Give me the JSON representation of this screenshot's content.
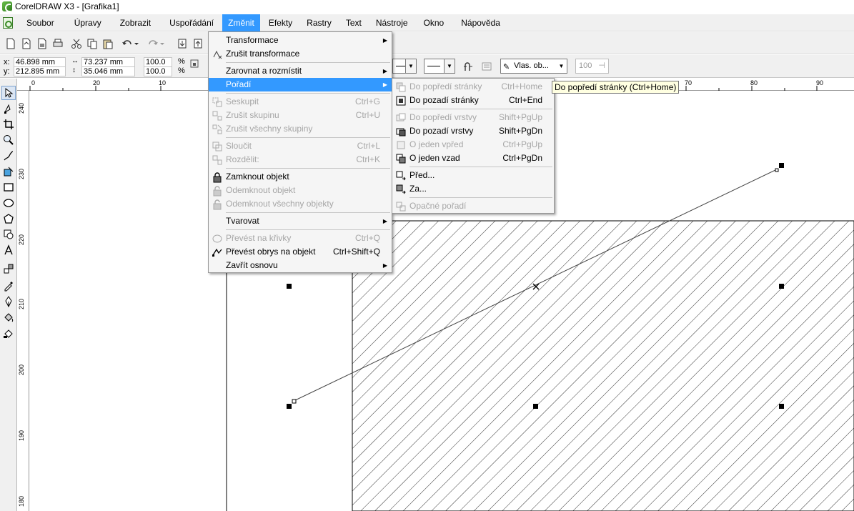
{
  "window": {
    "title": "CorelDRAW X3 - [Grafika1]"
  },
  "menubar": {
    "items": [
      "Soubor",
      "Úpravy",
      "Zobrazit",
      "Uspořádání",
      "Změnit",
      "Efekty",
      "Rastry",
      "Text",
      "Nástroje",
      "Okno",
      "Nápověda"
    ],
    "active": "Změnit"
  },
  "propbar": {
    "x_label": "x:",
    "x_value": "46.898 mm",
    "y_label": "y:",
    "y_value": "212.895 mm",
    "w_value": "73.237 mm",
    "h_value": "35.046 mm",
    "sx_value": "100.0",
    "sy_value": "100.0",
    "pct1": "%",
    "pct2": "%",
    "outline_combo": "Vlas. ob...",
    "opacity_value": "100"
  },
  "rulers": {
    "h_ticks": [
      "0",
      "20",
      "10",
      "70",
      "80",
      "90"
    ],
    "v_ticks": [
      "240",
      "230",
      "220",
      "210",
      "200",
      "190",
      "180"
    ]
  },
  "menu_zmenit": {
    "items": [
      {
        "label": "Transformace",
        "shortcut": "",
        "submenu": true,
        "disabled": false
      },
      {
        "label": "Zrušit transformace",
        "shortcut": "",
        "submenu": false,
        "disabled": false
      },
      {
        "label": "Zarovnat a rozmístit",
        "shortcut": "",
        "submenu": true,
        "disabled": false
      },
      {
        "label": "Pořadí",
        "shortcut": "",
        "submenu": true,
        "disabled": false,
        "highlighted": true
      },
      {
        "label": "Seskupit",
        "shortcut": "Ctrl+G",
        "submenu": false,
        "disabled": true
      },
      {
        "label": "Zrušit skupinu",
        "shortcut": "Ctrl+U",
        "submenu": false,
        "disabled": true
      },
      {
        "label": "Zrušit všechny skupiny",
        "shortcut": "",
        "submenu": false,
        "disabled": true
      },
      {
        "label": "Sloučit",
        "shortcut": "Ctrl+L",
        "submenu": false,
        "disabled": true
      },
      {
        "label": "Rozdělit:",
        "shortcut": "Ctrl+K",
        "submenu": false,
        "disabled": true
      },
      {
        "label": "Zamknout objekt",
        "shortcut": "",
        "submenu": false,
        "disabled": false
      },
      {
        "label": "Odemknout objekt",
        "shortcut": "",
        "submenu": false,
        "disabled": true
      },
      {
        "label": "Odemknout všechny objekty",
        "shortcut": "",
        "submenu": false,
        "disabled": true
      },
      {
        "label": "Tvarovat",
        "shortcut": "",
        "submenu": true,
        "disabled": false
      },
      {
        "label": "Převést na křivky",
        "shortcut": "Ctrl+Q",
        "submenu": false,
        "disabled": true
      },
      {
        "label": "Převést obrys na objekt",
        "shortcut": "Ctrl+Shift+Q",
        "submenu": false,
        "disabled": false
      },
      {
        "label": "Zavřít osnovu",
        "shortcut": "",
        "submenu": true,
        "disabled": false
      }
    ]
  },
  "menu_poradi": {
    "items": [
      {
        "label": "Do popředí stránky",
        "shortcut": "Ctrl+Home",
        "disabled": true
      },
      {
        "label": "Do pozadí stránky",
        "shortcut": "Ctrl+End",
        "disabled": false
      },
      {
        "label": "Do popředí vrstvy",
        "shortcut": "Shift+PgUp",
        "disabled": true
      },
      {
        "label": "Do pozadí vrstvy",
        "shortcut": "Shift+PgDn",
        "disabled": false
      },
      {
        "label": "O jeden vpřed",
        "shortcut": "Ctrl+PgUp",
        "disabled": true
      },
      {
        "label": "O jeden vzad",
        "shortcut": "Ctrl+PgDn",
        "disabled": false
      },
      {
        "label": "Před...",
        "shortcut": "",
        "disabled": false
      },
      {
        "label": "Za...",
        "shortcut": "",
        "disabled": false
      },
      {
        "label": "Opačné pořadí",
        "shortcut": "",
        "disabled": true
      }
    ]
  },
  "tooltip": {
    "text": "Do popředí stránky (Ctrl+Home)"
  },
  "colors": {
    "highlight": "#3399ff",
    "menu_bg": "#f5f5f5",
    "tooltip_bg": "#ffffe1"
  }
}
